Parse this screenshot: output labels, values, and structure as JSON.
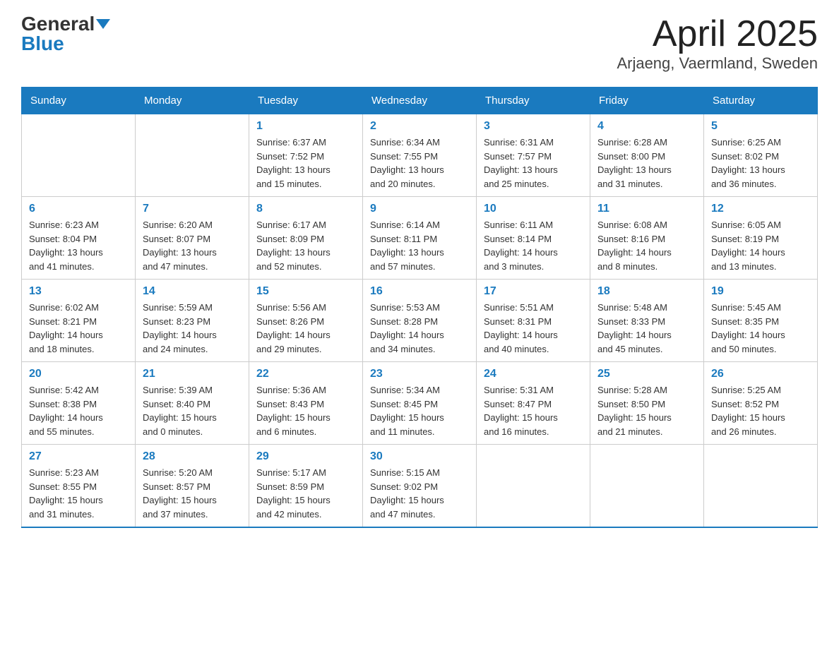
{
  "logo": {
    "general": "General",
    "blue": "Blue"
  },
  "title": "April 2025",
  "subtitle": "Arjaeng, Vaermland, Sweden",
  "weekdays": [
    "Sunday",
    "Monday",
    "Tuesday",
    "Wednesday",
    "Thursday",
    "Friday",
    "Saturday"
  ],
  "weeks": [
    [
      {
        "day": "",
        "info": ""
      },
      {
        "day": "",
        "info": ""
      },
      {
        "day": "1",
        "info": "Sunrise: 6:37 AM\nSunset: 7:52 PM\nDaylight: 13 hours\nand 15 minutes."
      },
      {
        "day": "2",
        "info": "Sunrise: 6:34 AM\nSunset: 7:55 PM\nDaylight: 13 hours\nand 20 minutes."
      },
      {
        "day": "3",
        "info": "Sunrise: 6:31 AM\nSunset: 7:57 PM\nDaylight: 13 hours\nand 25 minutes."
      },
      {
        "day": "4",
        "info": "Sunrise: 6:28 AM\nSunset: 8:00 PM\nDaylight: 13 hours\nand 31 minutes."
      },
      {
        "day": "5",
        "info": "Sunrise: 6:25 AM\nSunset: 8:02 PM\nDaylight: 13 hours\nand 36 minutes."
      }
    ],
    [
      {
        "day": "6",
        "info": "Sunrise: 6:23 AM\nSunset: 8:04 PM\nDaylight: 13 hours\nand 41 minutes."
      },
      {
        "day": "7",
        "info": "Sunrise: 6:20 AM\nSunset: 8:07 PM\nDaylight: 13 hours\nand 47 minutes."
      },
      {
        "day": "8",
        "info": "Sunrise: 6:17 AM\nSunset: 8:09 PM\nDaylight: 13 hours\nand 52 minutes."
      },
      {
        "day": "9",
        "info": "Sunrise: 6:14 AM\nSunset: 8:11 PM\nDaylight: 13 hours\nand 57 minutes."
      },
      {
        "day": "10",
        "info": "Sunrise: 6:11 AM\nSunset: 8:14 PM\nDaylight: 14 hours\nand 3 minutes."
      },
      {
        "day": "11",
        "info": "Sunrise: 6:08 AM\nSunset: 8:16 PM\nDaylight: 14 hours\nand 8 minutes."
      },
      {
        "day": "12",
        "info": "Sunrise: 6:05 AM\nSunset: 8:19 PM\nDaylight: 14 hours\nand 13 minutes."
      }
    ],
    [
      {
        "day": "13",
        "info": "Sunrise: 6:02 AM\nSunset: 8:21 PM\nDaylight: 14 hours\nand 18 minutes."
      },
      {
        "day": "14",
        "info": "Sunrise: 5:59 AM\nSunset: 8:23 PM\nDaylight: 14 hours\nand 24 minutes."
      },
      {
        "day": "15",
        "info": "Sunrise: 5:56 AM\nSunset: 8:26 PM\nDaylight: 14 hours\nand 29 minutes."
      },
      {
        "day": "16",
        "info": "Sunrise: 5:53 AM\nSunset: 8:28 PM\nDaylight: 14 hours\nand 34 minutes."
      },
      {
        "day": "17",
        "info": "Sunrise: 5:51 AM\nSunset: 8:31 PM\nDaylight: 14 hours\nand 40 minutes."
      },
      {
        "day": "18",
        "info": "Sunrise: 5:48 AM\nSunset: 8:33 PM\nDaylight: 14 hours\nand 45 minutes."
      },
      {
        "day": "19",
        "info": "Sunrise: 5:45 AM\nSunset: 8:35 PM\nDaylight: 14 hours\nand 50 minutes."
      }
    ],
    [
      {
        "day": "20",
        "info": "Sunrise: 5:42 AM\nSunset: 8:38 PM\nDaylight: 14 hours\nand 55 minutes."
      },
      {
        "day": "21",
        "info": "Sunrise: 5:39 AM\nSunset: 8:40 PM\nDaylight: 15 hours\nand 0 minutes."
      },
      {
        "day": "22",
        "info": "Sunrise: 5:36 AM\nSunset: 8:43 PM\nDaylight: 15 hours\nand 6 minutes."
      },
      {
        "day": "23",
        "info": "Sunrise: 5:34 AM\nSunset: 8:45 PM\nDaylight: 15 hours\nand 11 minutes."
      },
      {
        "day": "24",
        "info": "Sunrise: 5:31 AM\nSunset: 8:47 PM\nDaylight: 15 hours\nand 16 minutes."
      },
      {
        "day": "25",
        "info": "Sunrise: 5:28 AM\nSunset: 8:50 PM\nDaylight: 15 hours\nand 21 minutes."
      },
      {
        "day": "26",
        "info": "Sunrise: 5:25 AM\nSunset: 8:52 PM\nDaylight: 15 hours\nand 26 minutes."
      }
    ],
    [
      {
        "day": "27",
        "info": "Sunrise: 5:23 AM\nSunset: 8:55 PM\nDaylight: 15 hours\nand 31 minutes."
      },
      {
        "day": "28",
        "info": "Sunrise: 5:20 AM\nSunset: 8:57 PM\nDaylight: 15 hours\nand 37 minutes."
      },
      {
        "day": "29",
        "info": "Sunrise: 5:17 AM\nSunset: 8:59 PM\nDaylight: 15 hours\nand 42 minutes."
      },
      {
        "day": "30",
        "info": "Sunrise: 5:15 AM\nSunset: 9:02 PM\nDaylight: 15 hours\nand 47 minutes."
      },
      {
        "day": "",
        "info": ""
      },
      {
        "day": "",
        "info": ""
      },
      {
        "day": "",
        "info": ""
      }
    ]
  ]
}
